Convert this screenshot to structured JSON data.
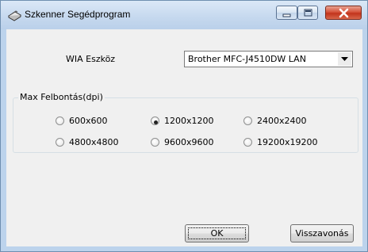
{
  "window": {
    "title": "Szkenner Segédprogram"
  },
  "device": {
    "label": "WIA Eszköz",
    "selected": "Brother MFC-J4510DW LAN"
  },
  "resolution": {
    "group_title": "Max Felbontás(dpi)",
    "selected": "1200x1200",
    "options": [
      "600x600",
      "1200x1200",
      "2400x2400",
      "4800x4800",
      "9600x9600",
      "19200x19200"
    ]
  },
  "buttons": {
    "ok": "OK",
    "cancel": "Visszavonás"
  }
}
